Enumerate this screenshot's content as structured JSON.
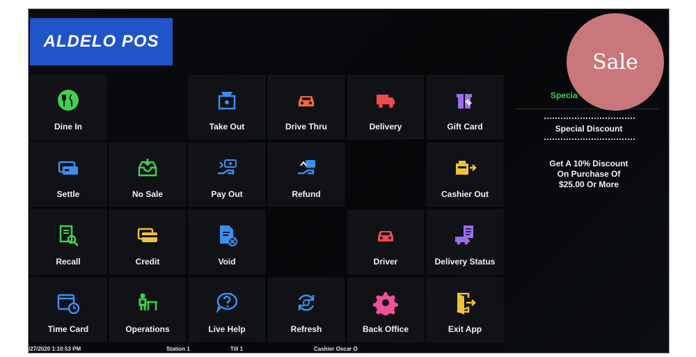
{
  "app": {
    "logo_text": "ALDELO POS"
  },
  "tiles": [
    {
      "label": "Dine In",
      "icon": "dine-in-icon",
      "color": "#3fd24f"
    },
    {
      "label": "",
      "icon": "",
      "color": ""
    },
    {
      "label": "Take Out",
      "icon": "take-out-icon",
      "color": "#3b8ff0"
    },
    {
      "label": "Drive Thru",
      "icon": "drive-thru-icon",
      "color": "#f26b3a"
    },
    {
      "label": "Delivery",
      "icon": "delivery-truck-icon",
      "color": "#f04a4a"
    },
    {
      "label": "Gift Card",
      "icon": "gift-card-icon",
      "color": "#9b6cf0"
    },
    {
      "label": "Settle",
      "icon": "settle-icon",
      "color": "#3b8ff0"
    },
    {
      "label": "No Sale",
      "icon": "no-sale-icon",
      "color": "#3fd24f"
    },
    {
      "label": "Pay Out",
      "icon": "pay-out-icon",
      "color": "#3b8ff0"
    },
    {
      "label": "Refund",
      "icon": "refund-icon",
      "color": "#3b8ff0"
    },
    {
      "label": "",
      "icon": "",
      "color": ""
    },
    {
      "label": "Cashier Out",
      "icon": "cashier-out-icon",
      "color": "#f0c23a"
    },
    {
      "label": "Recall",
      "icon": "recall-icon",
      "color": "#3fd24f"
    },
    {
      "label": "Credit",
      "icon": "credit-icon",
      "color": "#f0c23a"
    },
    {
      "label": "Void",
      "icon": "void-icon",
      "color": "#3b8ff0"
    },
    {
      "label": "",
      "icon": "",
      "color": ""
    },
    {
      "label": "Driver",
      "icon": "driver-icon",
      "color": "#f04a4a"
    },
    {
      "label": "Delivery Status",
      "icon": "delivery-status-icon",
      "color": "#9b6cf0"
    },
    {
      "label": "Time Card",
      "icon": "time-card-icon",
      "color": "#3b8ff0"
    },
    {
      "label": "Operations",
      "icon": "operations-icon",
      "color": "#3fd24f"
    },
    {
      "label": "Live Help",
      "icon": "live-help-icon",
      "color": "#3b8ff0"
    },
    {
      "label": "Refresh",
      "icon": "refresh-icon",
      "color": "#3b8ff0"
    },
    {
      "label": "Back Office",
      "icon": "back-office-gear-icon",
      "color": "#f0509a"
    },
    {
      "label": "Exit App",
      "icon": "exit-app-icon",
      "color": "#f0c23a"
    }
  ],
  "specials": {
    "header": "Specia",
    "title": "Special Discount",
    "body_lines": [
      "Get A 10% Discount",
      "On Purchase Of",
      "$25.00 Or More"
    ]
  },
  "status": {
    "datetime": "/27/2020 1:10:53 PM",
    "station": "Station 1",
    "till": "Till 1",
    "cashier": "Cashier Oscar O"
  },
  "badge": {
    "text": "Sale"
  },
  "colors": {
    "screen_bg": "#07080b",
    "logo_bg": "#1f55c8",
    "badge_bg": "#c9777b",
    "special_header": "#3fd24f"
  }
}
